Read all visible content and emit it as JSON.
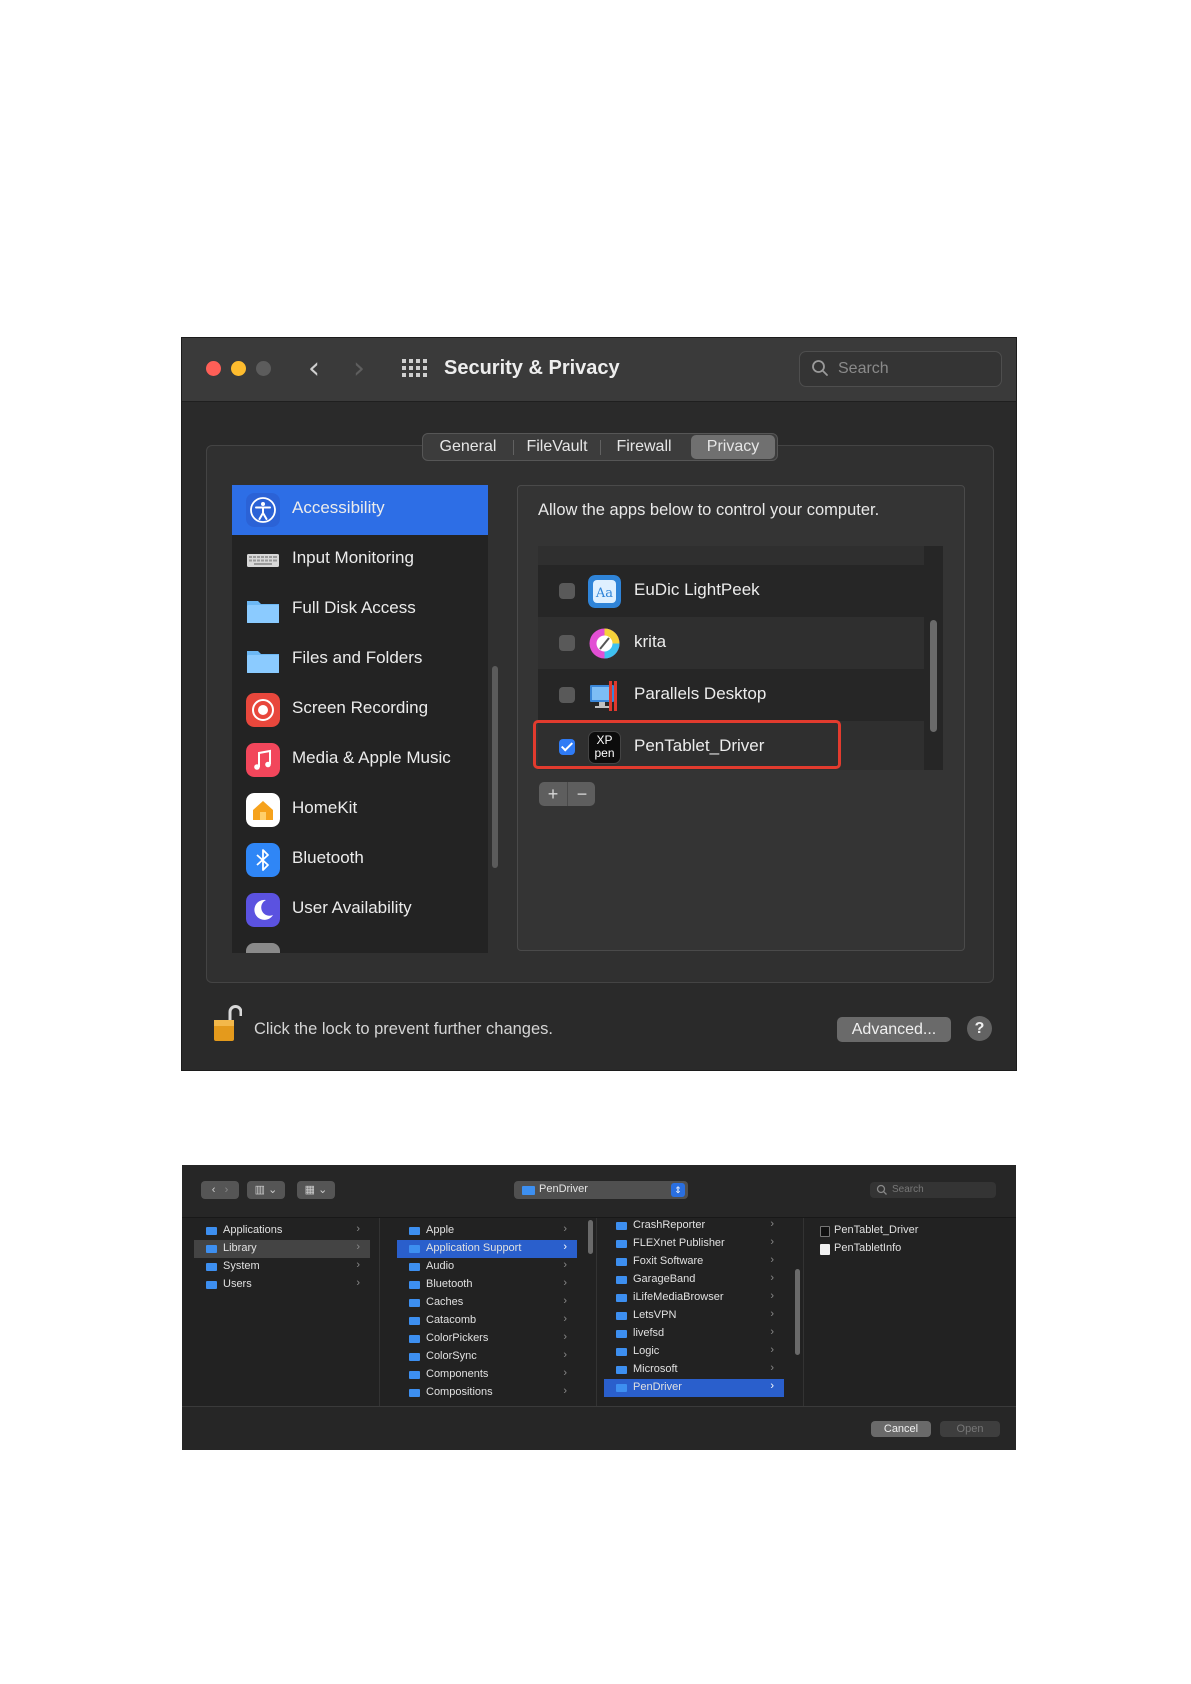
{
  "security_window": {
    "title": "Security & Privacy",
    "search_placeholder": "Search",
    "tabs": [
      "General",
      "FileVault",
      "Firewall",
      "Privacy"
    ],
    "selected_tab": "Privacy",
    "sidebar": [
      {
        "label": "Accessibility",
        "icon": "accessibility-icon",
        "selected": true
      },
      {
        "label": "Input Monitoring",
        "icon": "keyboard-icon"
      },
      {
        "label": "Full Disk Access",
        "icon": "folder-icon"
      },
      {
        "label": "Files and Folders",
        "icon": "folder-icon"
      },
      {
        "label": "Screen Recording",
        "icon": "screen-recording-icon"
      },
      {
        "label": "Media & Apple Music",
        "icon": "music-icon"
      },
      {
        "label": "HomeKit",
        "icon": "homekit-icon"
      },
      {
        "label": "Bluetooth",
        "icon": "bluetooth-icon"
      },
      {
        "label": "User Availability",
        "icon": "moon-icon"
      }
    ],
    "panel_heading": "Allow the apps below to control your computer.",
    "apps": [
      {
        "label": "EuDic LightPeek",
        "checked": false,
        "icon": "eudic-icon"
      },
      {
        "label": "krita",
        "checked": false,
        "icon": "krita-icon"
      },
      {
        "label": "Parallels Desktop",
        "checked": false,
        "icon": "parallels-icon"
      },
      {
        "label": "PenTablet_Driver",
        "checked": true,
        "icon": "xppen-icon"
      }
    ],
    "xppen_icon_text_top": "XP",
    "xppen_icon_text_bottom": "pen",
    "add_label": "+",
    "remove_label": "−",
    "lock_text": "Click the lock to prevent further changes.",
    "advanced_label": "Advanced...",
    "help_label": "?",
    "colors": {
      "selection": "#2d6ee6",
      "highlight_box": "#e23b2e",
      "checkbox_on": "#2f7bf5"
    }
  },
  "finder_window": {
    "location": "PenDriver",
    "search_placeholder": "Search",
    "col1": [
      {
        "label": "Applications"
      },
      {
        "label": "Library",
        "state": "gray"
      },
      {
        "label": "System"
      },
      {
        "label": "Users"
      }
    ],
    "col2": [
      {
        "label": "Apple"
      },
      {
        "label": "Application Support",
        "state": "sel"
      },
      {
        "label": "Audio"
      },
      {
        "label": "Bluetooth"
      },
      {
        "label": "Caches"
      },
      {
        "label": "Catacomb"
      },
      {
        "label": "ColorPickers"
      },
      {
        "label": "ColorSync"
      },
      {
        "label": "Components"
      },
      {
        "label": "Compositions"
      }
    ],
    "col3": [
      {
        "label": "CrashReporter"
      },
      {
        "label": "FLEXnet Publisher"
      },
      {
        "label": "Foxit Software"
      },
      {
        "label": "GarageBand"
      },
      {
        "label": "iLifeMediaBrowser"
      },
      {
        "label": "LetsVPN"
      },
      {
        "label": "livefsd"
      },
      {
        "label": "Logic"
      },
      {
        "label": "Microsoft"
      },
      {
        "label": "PenDriver",
        "state": "sel"
      }
    ],
    "col4": [
      {
        "label": "PenTablet_Driver",
        "icon": "dark"
      },
      {
        "label": "PenTabletInfo",
        "icon": "white"
      }
    ],
    "cancel_label": "Cancel",
    "open_label": "Open"
  }
}
